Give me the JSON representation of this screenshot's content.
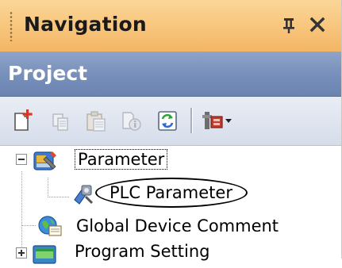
{
  "panel": {
    "title": "Navigation",
    "pin_glyph": "Д",
    "close_glyph": "✕"
  },
  "project": {
    "header": "Project"
  },
  "toolbar": {
    "buttons": [
      {
        "icon": "new-data-icon"
      },
      {
        "icon": "copy-icon"
      },
      {
        "icon": "paste-icon"
      },
      {
        "icon": "properties-icon"
      },
      {
        "icon": "refresh-icon"
      },
      {
        "icon": "tools-dropdown-icon"
      }
    ]
  },
  "tree": {
    "items": [
      {
        "label": "Parameter",
        "expander": "minus",
        "icon": "parameter-folder-icon"
      },
      {
        "label": "PLC Parameter",
        "icon": "plc-parameter-icon"
      },
      {
        "label": "Global Device Comment",
        "icon": "global-device-comment-icon"
      },
      {
        "label": "Program Setting",
        "expander": "plus",
        "icon": "program-setting-icon"
      }
    ]
  },
  "colors": {
    "title_bar": "#f8c880",
    "project_bar": "#7890bb",
    "toolbar": "#dfe4ee"
  }
}
